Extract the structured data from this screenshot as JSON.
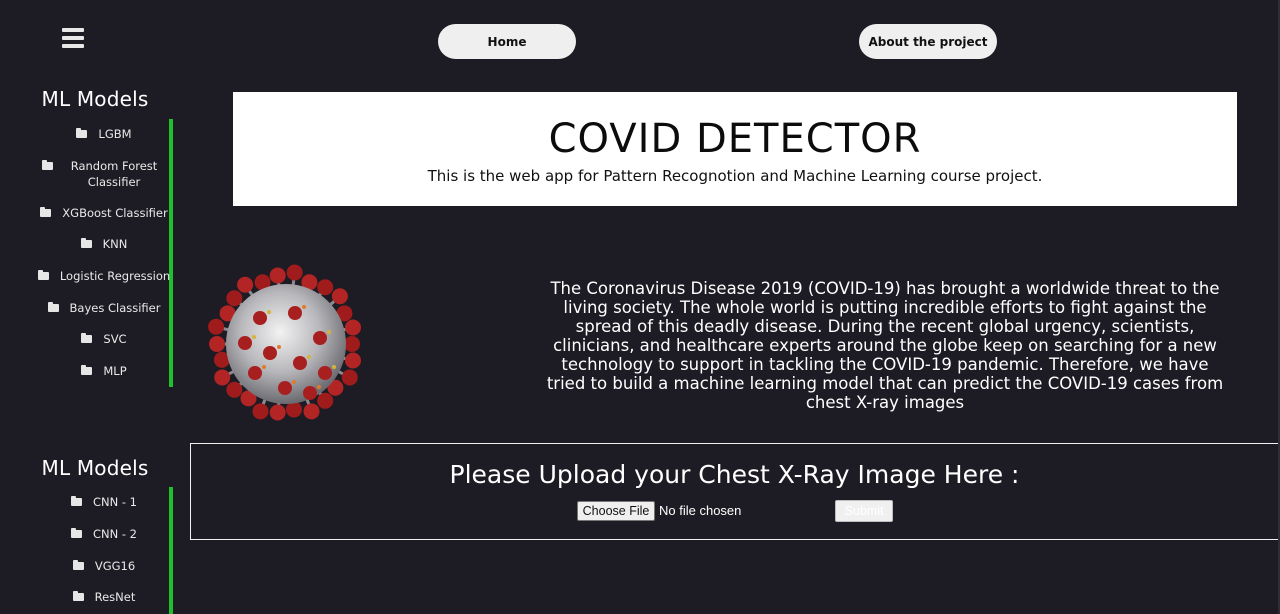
{
  "nav": {
    "home_label": "Home",
    "about_label": "About the project"
  },
  "sidebar": {
    "section1": {
      "title": "ML Models",
      "items": [
        {
          "label": "LGBM"
        },
        {
          "label": "Random Forest Classifier"
        },
        {
          "label": "XGBoost Classifier"
        },
        {
          "label": "KNN"
        },
        {
          "label": "Logistic Regression"
        },
        {
          "label": "Bayes Classifier"
        },
        {
          "label": "SVC"
        },
        {
          "label": "MLP"
        }
      ]
    },
    "section2": {
      "title": "ML Models",
      "items": [
        {
          "label": "CNN - 1"
        },
        {
          "label": "CNN - 2"
        },
        {
          "label": "VGG16"
        },
        {
          "label": "ResNet"
        }
      ]
    }
  },
  "header": {
    "title": "COVID DETECTOR",
    "subtitle": "This is the web app for Pattern Recognotion and Machine Learning course project."
  },
  "description": "The Coronavirus Disease 2019 (COVID-19) has brought a worldwide threat to the living society. The whole world is putting incredible efforts to fight against the spread of this deadly disease. During the recent global urgency, scientists, clinicians, and healthcare experts around the globe keep on searching for a new technology to support in tackling the COVID-19 pandemic. Therefore, we have tried to build a machine learning model that can predict the COVID-19 cases from chest X-ray images",
  "upload": {
    "title": "Please Upload your Chest X-Ray Image Here :",
    "choose_label": "Choose File",
    "file_status": "No file chosen",
    "submit_label": "Submit"
  },
  "colors": {
    "background": "#1d1c24",
    "accent_bar": "#1fc02e",
    "card": "#ffffff"
  },
  "icons": {
    "menu": "hamburger-menu-icon",
    "sidebar_item": "folder-icon",
    "illustration": "coronavirus-image"
  }
}
